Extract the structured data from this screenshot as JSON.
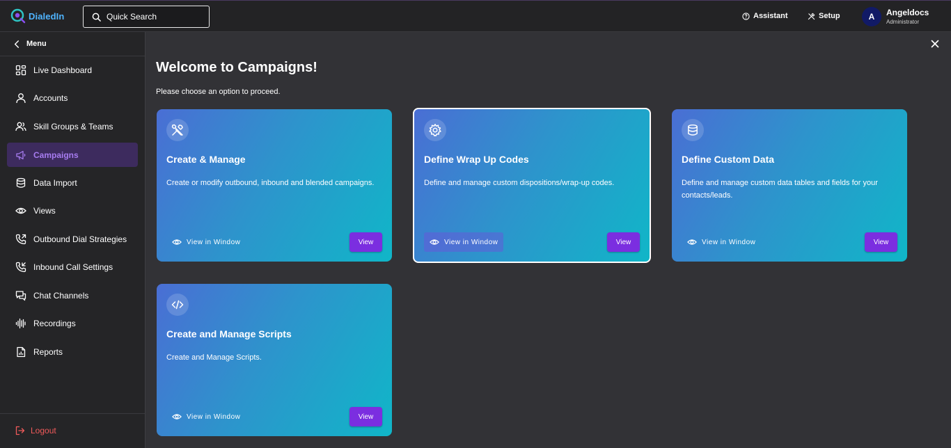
{
  "header": {
    "logo_text": "DialedIn",
    "search_label": "Quick Search",
    "assistant_label": "Assistant",
    "setup_label": "Setup",
    "user": {
      "initial": "A",
      "name": "Angeldocs",
      "role": "Administrator"
    }
  },
  "sidebar": {
    "menu_label": "Menu",
    "items": [
      {
        "label": "Live Dashboard",
        "icon": "dashboard-icon"
      },
      {
        "label": "Accounts",
        "icon": "user-icon"
      },
      {
        "label": "Skill Groups & Teams",
        "icon": "users-icon"
      },
      {
        "label": "Campaigns",
        "icon": "megaphone-icon",
        "active": true
      },
      {
        "label": "Data Import",
        "icon": "database-icon"
      },
      {
        "label": "Views",
        "icon": "eye-icon"
      },
      {
        "label": "Outbound Dial Strategies",
        "icon": "phone-outgoing-icon"
      },
      {
        "label": "Inbound Call Settings",
        "icon": "phone-incoming-icon"
      },
      {
        "label": "Chat Channels",
        "icon": "chat-icon"
      },
      {
        "label": "Recordings",
        "icon": "audio-wave-icon"
      },
      {
        "label": "Reports",
        "icon": "report-icon"
      }
    ],
    "logout_label": "Logout"
  },
  "main": {
    "title": "Welcome to Campaigns!",
    "subtitle": "Please choose an option to proceed.",
    "cards": [
      {
        "title": "Create & Manage",
        "description": "Create or modify outbound, inbound and blended campaigns.",
        "view_window_label": "View in Window",
        "view_label": "View",
        "icon": "tools-icon"
      },
      {
        "title": "Define Wrap Up Codes",
        "description": "Define and manage custom dispositions/wrap-up codes.",
        "view_window_label": "View in Window",
        "view_label": "View",
        "icon": "gear-icon"
      },
      {
        "title": "Define Custom Data",
        "description": "Define and manage custom data tables and fields for your contacts/leads.",
        "view_window_label": "View in Window",
        "view_label": "View",
        "icon": "database-icon"
      },
      {
        "title": "Create and Manage Scripts",
        "description": "Create and Manage Scripts.",
        "view_window_label": "View in Window",
        "view_label": "View",
        "icon": "code-icon"
      }
    ]
  },
  "colors": {
    "accent": "#7b2ee0",
    "active_nav_bg": "#3d2b5e",
    "active_nav_text": "#a77cf0",
    "logout": "#f05a5a",
    "card_gradient_start": "#4a6ed4",
    "card_gradient_end": "#10b6c8"
  }
}
